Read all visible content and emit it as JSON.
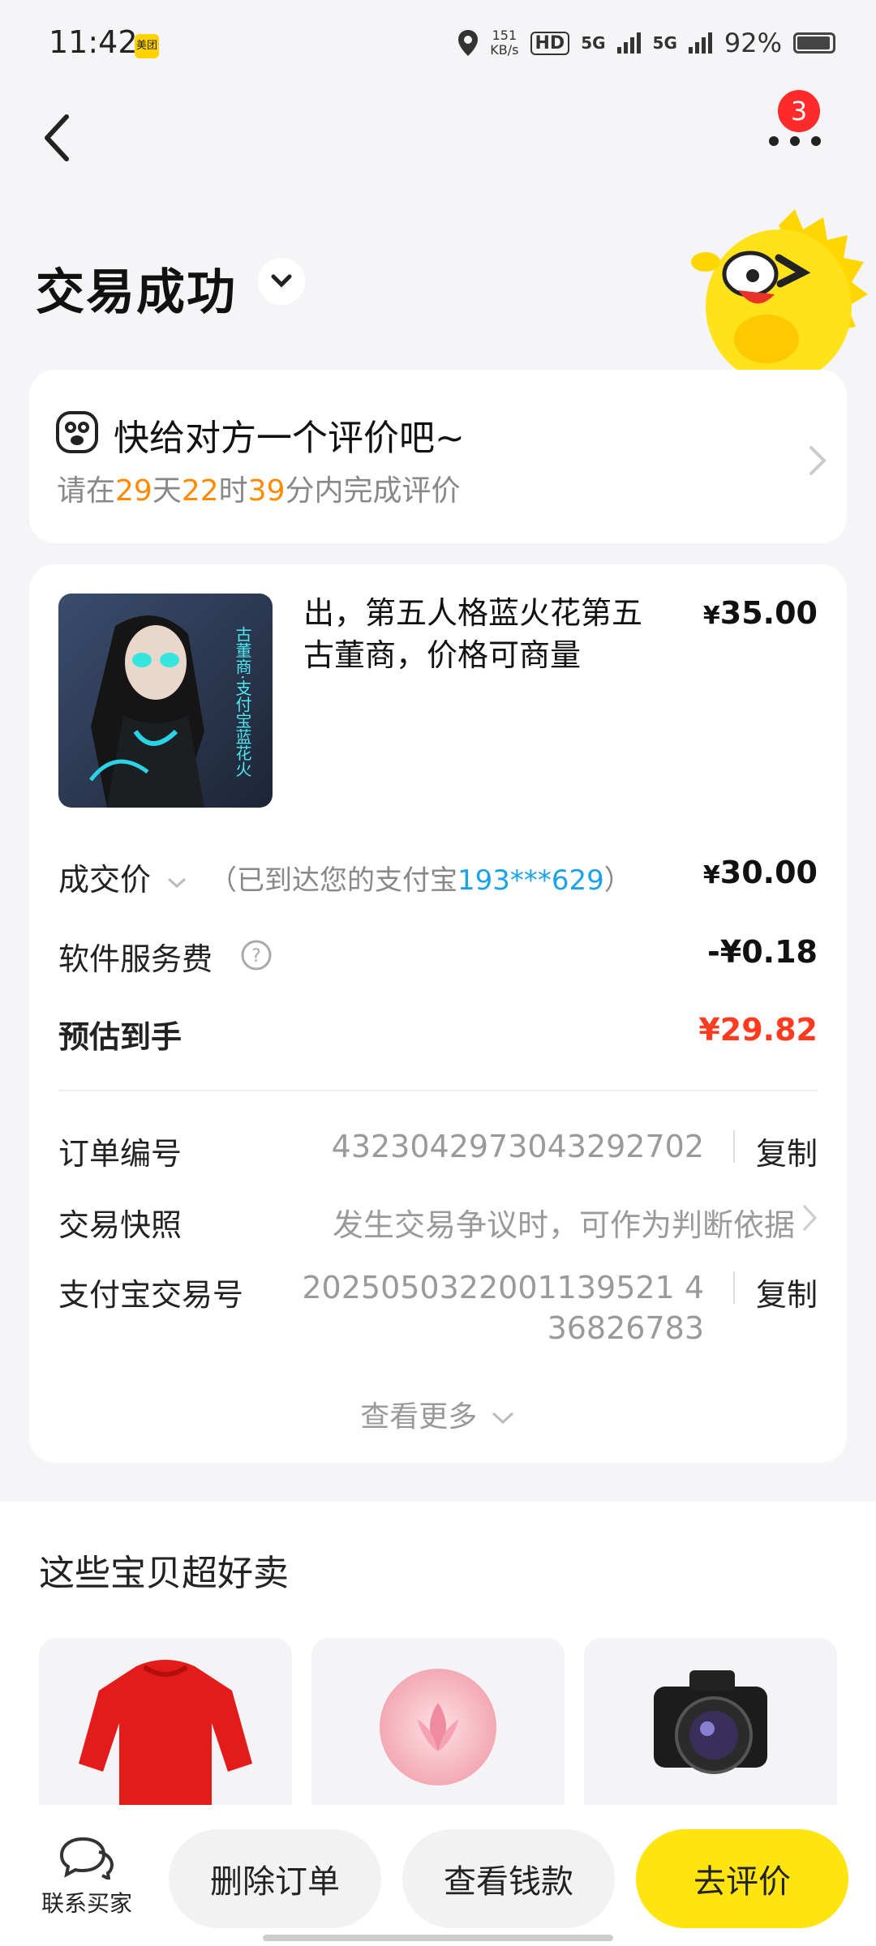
{
  "status_bar": {
    "time": "11:42",
    "app_badge": "美团",
    "network_speed_value": "151",
    "network_speed_unit": "KB/s",
    "hd_label": "HD",
    "signal1": "5G",
    "signal2": "5G",
    "battery_text": "92%"
  },
  "nav": {
    "badge_count": "3"
  },
  "page": {
    "title": "交易成功"
  },
  "review": {
    "title": "快给对方一个评价吧~",
    "prefix": "请在",
    "days": "29",
    "days_unit": "天",
    "hours": "22",
    "hours_unit": "时",
    "minutes": "39",
    "minutes_unit": "分",
    "suffix": "内完成评价"
  },
  "product": {
    "title": "出，第五人格蓝火花第五古董商，价格可商量",
    "currency": "¥",
    "price": "35.00",
    "image_caption": "古董商·支付宝蓝花火"
  },
  "pricing": {
    "deal_label": "成交价",
    "deal_note_prefix": "（已到达您的支付宝",
    "deal_note_account": "193***629",
    "deal_note_suffix": "）",
    "deal_currency": "¥",
    "deal_value": "30.00",
    "fee_label": "软件服务费",
    "fee_value": "-¥0.18",
    "estimate_label": "预估到手",
    "estimate_value": "¥29.82"
  },
  "order_info": {
    "order_no_label": "订单编号",
    "order_no": "4323042973043292702",
    "copy_label": "复制",
    "snapshot_label": "交易快照",
    "snapshot_value": "发生交易争议时，可作为判断依据",
    "alipay_label": "支付宝交易号",
    "alipay_no_line1": "2025050322001139521 4",
    "alipay_no_line2": "36826783",
    "more_label": "查看更多"
  },
  "recommendations": {
    "title": "这些宝贝超好卖",
    "items": [
      "red-sweater",
      "pink-flower-ball",
      "canon-camera"
    ]
  },
  "bottom_bar": {
    "contact_label": "联系买家",
    "delete_label": "删除订单",
    "view_money_label": "查看钱款",
    "review_label": "去评价"
  },
  "colors": {
    "accent_yellow": "#ffe40f",
    "countdown_orange": "#ff8a00",
    "price_red": "#ff3b1f",
    "link_blue": "#1aa3e8",
    "badge_red": "#ff2b2b"
  }
}
